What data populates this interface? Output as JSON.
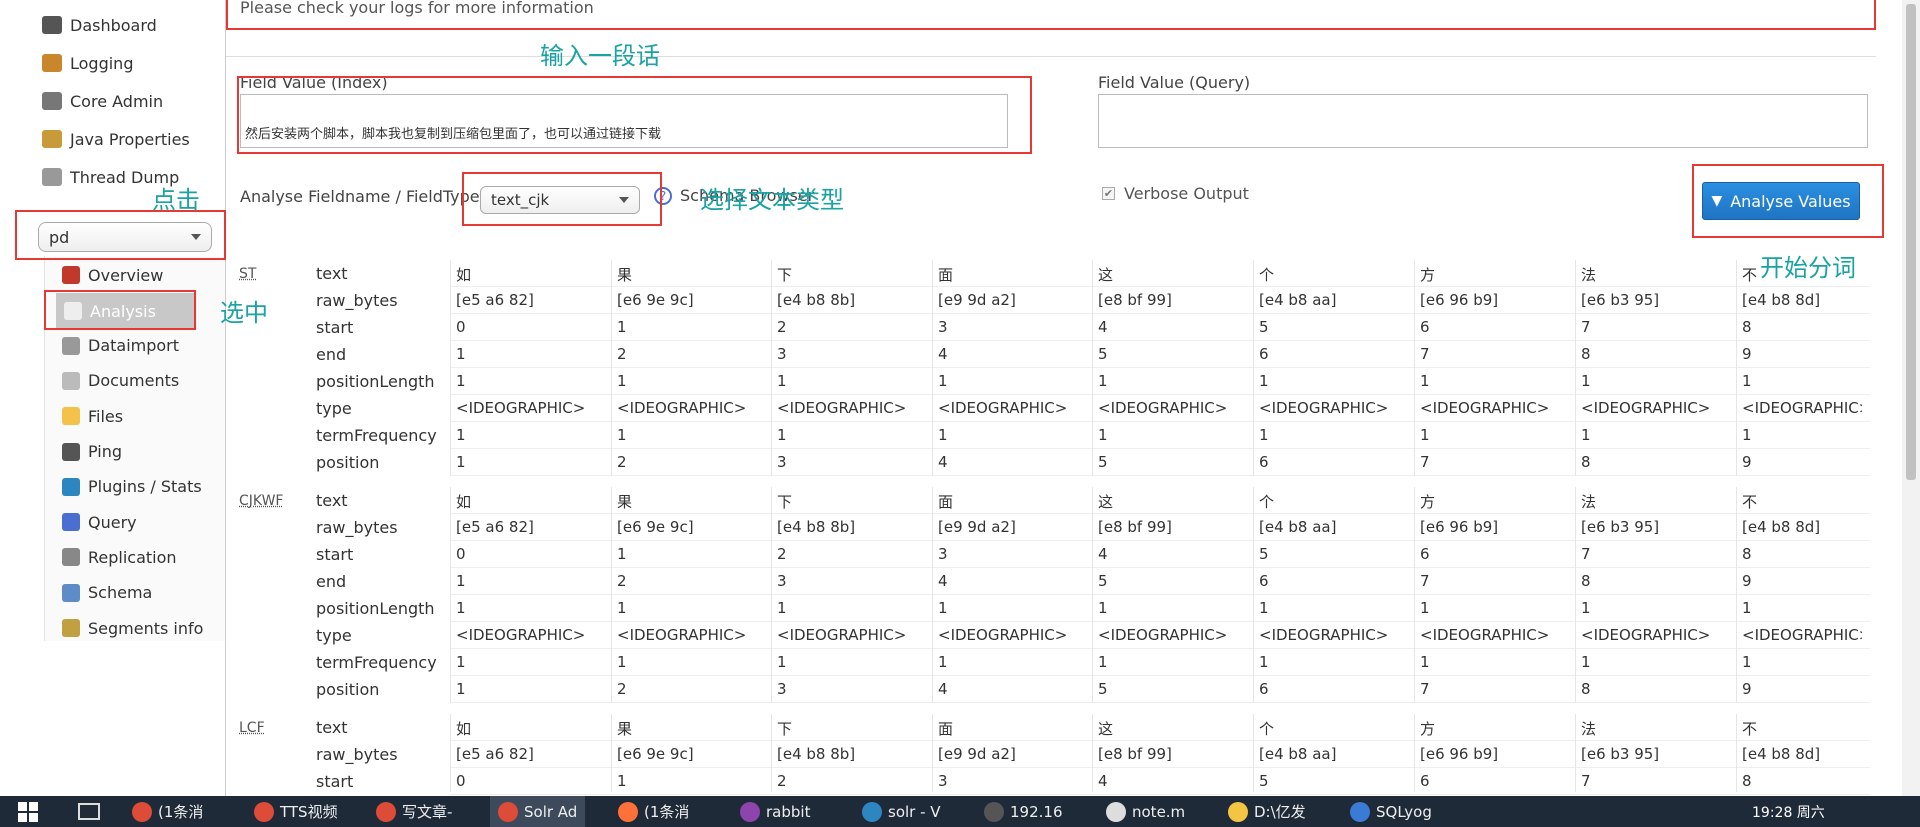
{
  "error_message": "Please check your logs for more information",
  "sidebar": {
    "items": [
      {
        "label": "Dashboard",
        "icon": "dashboard-icon"
      },
      {
        "label": "Logging",
        "icon": "logging-icon"
      },
      {
        "label": "Core Admin",
        "icon": "core-admin-icon"
      },
      {
        "label": "Java Properties",
        "icon": "java-properties-icon"
      },
      {
        "label": "Thread Dump",
        "icon": "thread-dump-icon"
      }
    ],
    "core_selected": "pd",
    "core_items": [
      {
        "label": "Overview",
        "icon": "home-icon"
      },
      {
        "label": "Analysis",
        "icon": "funnel-icon"
      },
      {
        "label": "Dataimport",
        "icon": "dataimport-icon"
      },
      {
        "label": "Documents",
        "icon": "documents-icon"
      },
      {
        "label": "Files",
        "icon": "folder-icon"
      },
      {
        "label": "Ping",
        "icon": "ping-icon"
      },
      {
        "label": "Plugins / Stats",
        "icon": "plugins-icon"
      },
      {
        "label": "Query",
        "icon": "magnifier-icon"
      },
      {
        "label": "Replication",
        "icon": "replication-icon"
      },
      {
        "label": "Schema",
        "icon": "schema-icon"
      },
      {
        "label": "Segments info",
        "icon": "segments-icon"
      }
    ]
  },
  "form": {
    "index_label": "Field Value (Index)",
    "index_value": "然后安装两个脚本，脚本我也复制到压缩包里面了，也可以通过链接下载",
    "query_label": "Field Value (Query)",
    "query_value": "",
    "fieldtype_label": "Analyse Fieldname / FieldType:",
    "fieldtype_value": "text_cjk",
    "schema_browser": "Schema Browser",
    "verbose_label": "Verbose Output",
    "verbose_checked": true,
    "analyse_button": "Analyse Values"
  },
  "annotations": {
    "input_text": "输入一段话",
    "click": "点击",
    "select_type": "选择文本类型",
    "selected": "选中",
    "start": "开始分词"
  },
  "results": {
    "row_labels": [
      "text",
      "raw_bytes",
      "start",
      "end",
      "positionLength",
      "type",
      "termFrequency",
      "position"
    ],
    "sections": [
      {
        "name": "ST",
        "columns": [
          [
            "如",
            "[e5 a6 82]",
            "0",
            "1",
            "1",
            "<IDEOGRAPHIC>",
            "1",
            "1"
          ],
          [
            "果",
            "[e6 9e 9c]",
            "1",
            "2",
            "1",
            "<IDEOGRAPHIC>",
            "1",
            "2"
          ],
          [
            "下",
            "[e4 b8 8b]",
            "2",
            "3",
            "1",
            "<IDEOGRAPHIC>",
            "1",
            "3"
          ],
          [
            "面",
            "[e9 9d a2]",
            "3",
            "4",
            "1",
            "<IDEOGRAPHIC>",
            "1",
            "4"
          ],
          [
            "这",
            "[e8 bf 99]",
            "4",
            "5",
            "1",
            "<IDEOGRAPHIC>",
            "1",
            "5"
          ],
          [
            "个",
            "[e4 b8 aa]",
            "5",
            "6",
            "1",
            "<IDEOGRAPHIC>",
            "1",
            "6"
          ],
          [
            "方",
            "[e6 96 b9]",
            "6",
            "7",
            "1",
            "<IDEOGRAPHIC>",
            "1",
            "7"
          ],
          [
            "法",
            "[e6 b3 95]",
            "7",
            "8",
            "1",
            "<IDEOGRAPHIC>",
            "1",
            "8"
          ],
          [
            "不",
            "[e4 b8 8d]",
            "8",
            "9",
            "1",
            "<IDEOGRAPHIC>",
            "1",
            "9"
          ]
        ]
      },
      {
        "name": "CJKWF",
        "columns": [
          [
            "如",
            "[e5 a6 82]",
            "0",
            "1",
            "1",
            "<IDEOGRAPHIC>",
            "1",
            "1"
          ],
          [
            "果",
            "[e6 9e 9c]",
            "1",
            "2",
            "1",
            "<IDEOGRAPHIC>",
            "1",
            "2"
          ],
          [
            "下",
            "[e4 b8 8b]",
            "2",
            "3",
            "1",
            "<IDEOGRAPHIC>",
            "1",
            "3"
          ],
          [
            "面",
            "[e9 9d a2]",
            "3",
            "4",
            "1",
            "<IDEOGRAPHIC>",
            "1",
            "4"
          ],
          [
            "这",
            "[e8 bf 99]",
            "4",
            "5",
            "1",
            "<IDEOGRAPHIC>",
            "1",
            "5"
          ],
          [
            "个",
            "[e4 b8 aa]",
            "5",
            "6",
            "1",
            "<IDEOGRAPHIC>",
            "1",
            "6"
          ],
          [
            "方",
            "[e6 96 b9]",
            "6",
            "7",
            "1",
            "<IDEOGRAPHIC>",
            "1",
            "7"
          ],
          [
            "法",
            "[e6 b3 95]",
            "7",
            "8",
            "1",
            "<IDEOGRAPHIC>",
            "1",
            "8"
          ],
          [
            "不",
            "[e4 b8 8d]",
            "8",
            "9",
            "1",
            "<IDEOGRAPHIC>",
            "1",
            "9"
          ]
        ]
      },
      {
        "name": "LCF",
        "columns": [
          [
            "如",
            "[e5 a6 82]",
            "0"
          ],
          [
            "果",
            "[e6 9e 9c]",
            "1"
          ],
          [
            "下",
            "[e4 b8 8b]",
            "2"
          ],
          [
            "面",
            "[e9 9d a2]",
            "3"
          ],
          [
            "这",
            "[e8 bf 99]",
            "4"
          ],
          [
            "个",
            "[e4 b8 aa]",
            "5"
          ],
          [
            "方",
            "[e6 96 b9]",
            "6"
          ],
          [
            "法",
            "[e6 b3 95]",
            "7"
          ],
          [
            "不",
            "[e4 b8 8d]",
            "8"
          ]
        ]
      }
    ]
  },
  "taskbar": {
    "items": [
      {
        "label": "(1条消",
        "color": "#dd4b39"
      },
      {
        "label": "TTS视频",
        "color": "#dd4b39"
      },
      {
        "label": "写文章-",
        "color": "#dd4b39"
      },
      {
        "label": "Solr Ad",
        "color": "#dd4b39"
      },
      {
        "label": "(1条消",
        "color": "#ff7139"
      },
      {
        "label": "rabbit",
        "color": "#8e44ad"
      },
      {
        "label": "solr - V",
        "color": "#2e86c1"
      },
      {
        "label": "192.16",
        "color": "#555555"
      },
      {
        "label": "note.m",
        "color": "#dddddd"
      },
      {
        "label": "D:\\亿发",
        "color": "#f4c542"
      },
      {
        "label": "SQLyog",
        "color": "#3a7bd5"
      }
    ],
    "clock": "19:28 周六"
  },
  "colors": {
    "annotation_red": "#e53935",
    "annotation_teal": "#1aa3a3",
    "button_blue": "#1f74c4"
  }
}
